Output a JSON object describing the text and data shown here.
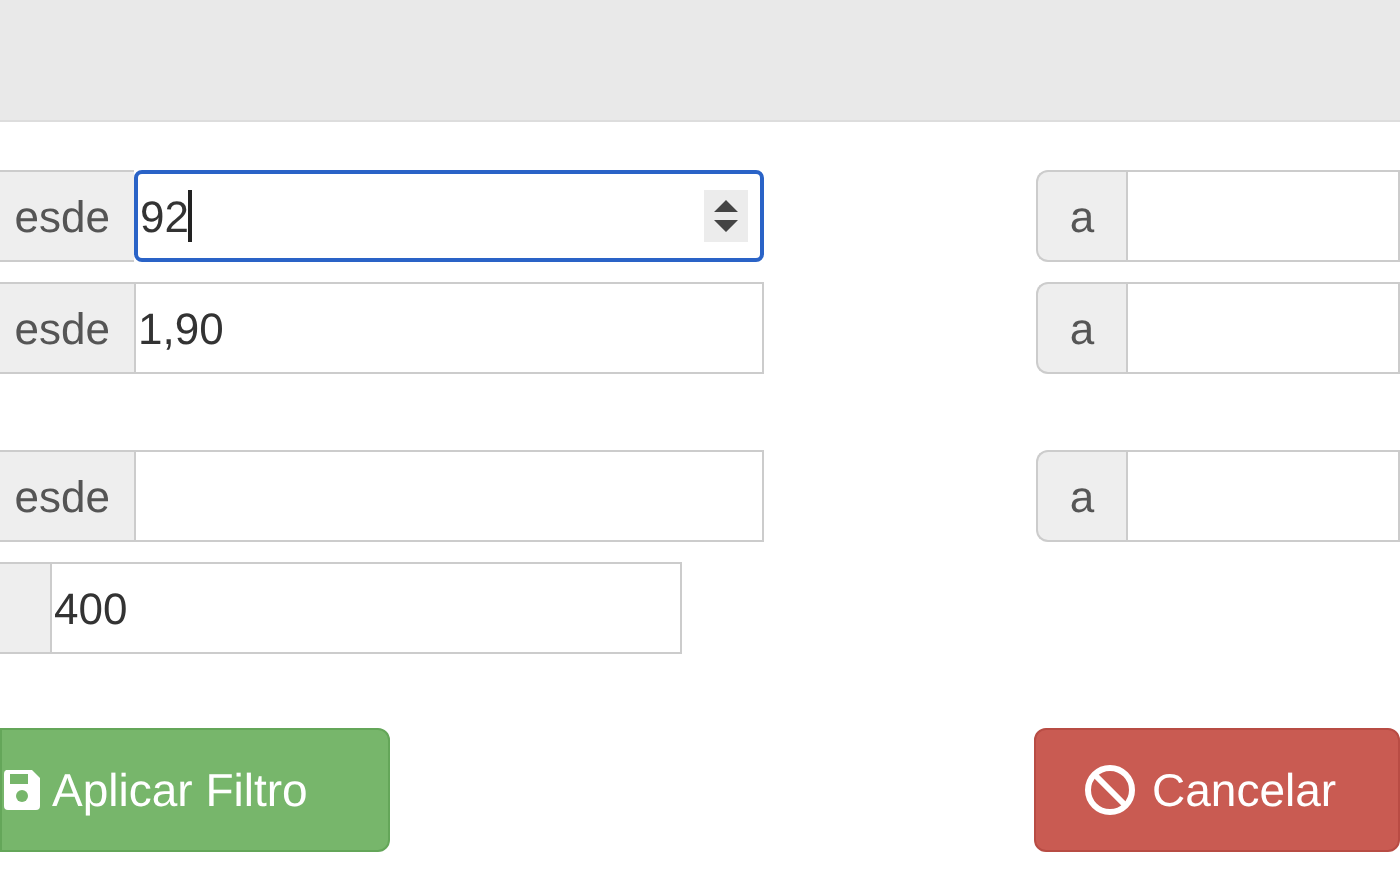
{
  "groups": [
    {
      "rows": [
        {
          "kind": "range",
          "from": {
            "addon": "esde",
            "value": "92",
            "kind": "number",
            "focused": true
          },
          "to": {
            "addon": "a"
          }
        },
        {
          "kind": "range",
          "from": {
            "addon": "esde",
            "value": "1,90",
            "kind": "text",
            "focused": false
          },
          "to": {
            "addon": "a"
          }
        }
      ]
    },
    {
      "rows": [
        {
          "kind": "range",
          "from": {
            "addon": "esde",
            "kind": "text",
            "focused": false
          },
          "to": {
            "addon": "a"
          }
        },
        {
          "kind": "single",
          "from": {
            "value": "400",
            "kind": "text",
            "focused": false
          }
        }
      ]
    }
  ],
  "buttons": [
    {
      "kind": "apply",
      "label": "Aplicar Filtro"
    },
    {
      "kind": "cancel",
      "label": "Cancelar"
    }
  ]
}
